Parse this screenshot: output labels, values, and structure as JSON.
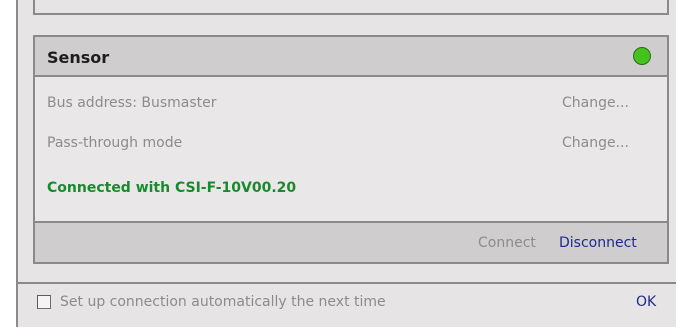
{
  "sensor": {
    "title": "Sensor",
    "status_color": "#46c21f",
    "rows": [
      {
        "label": "Bus address: Busmaster",
        "action": "Change..."
      },
      {
        "label": "Pass-through mode",
        "action": "Change..."
      }
    ],
    "connection_status": "Connected with CSI-F-10V00.20",
    "buttons": {
      "connect": "Connect",
      "disconnect": "Disconnect"
    }
  },
  "footer": {
    "auto_connect_label": "Set up connection automatically the next time",
    "auto_connect_checked": false,
    "ok_label": "OK"
  }
}
